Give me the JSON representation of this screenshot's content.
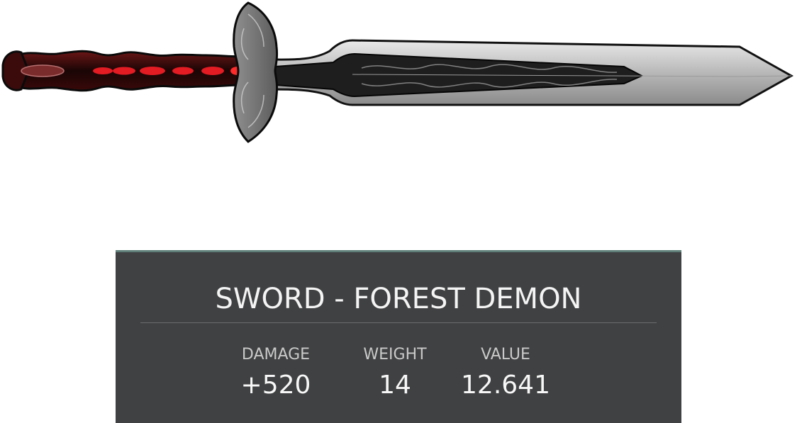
{
  "item": {
    "title": "SWORD - FOREST DEMON",
    "image_icon": "sword-icon"
  },
  "stats": {
    "damage_label": "DAMAGE",
    "damage_value": "+520",
    "weight_label": "WEIGHT",
    "weight_value": "14",
    "value_label": "VALUE",
    "value_value": "12.641"
  },
  "colors": {
    "panel_bg": "#404143",
    "panel_accent": "#5f7f78",
    "gem_red": "#e31b23",
    "blade_steel": "#bdbdbd"
  }
}
